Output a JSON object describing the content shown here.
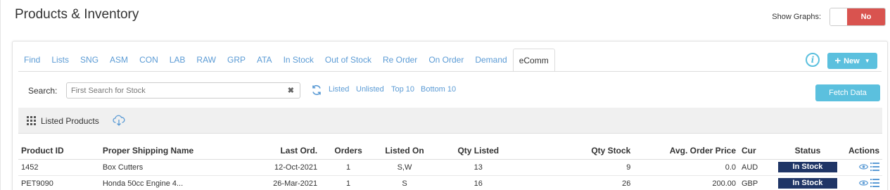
{
  "page": {
    "title": "Products & Inventory",
    "show_graphs_label": "Show Graphs:",
    "show_graphs_value": "No"
  },
  "tabs": [
    "Find",
    "Lists",
    "SNG",
    "ASM",
    "CON",
    "LAB",
    "RAW",
    "GRP",
    "ATA",
    "In Stock",
    "Out of Stock",
    "Re Order",
    "On Order",
    "Demand",
    "eComm"
  ],
  "active_tab": "eComm",
  "toolbar": {
    "new_label": "New",
    "search_label": "Search:",
    "search_placeholder": "First Search for Stock",
    "search_value": "",
    "filters": [
      "Listed",
      "Unlisted",
      "Top 10",
      "Bottom 10"
    ],
    "fetch_label": "Fetch Data"
  },
  "subbar": {
    "title": "Listed Products"
  },
  "table": {
    "headers": [
      "Product ID",
      "Proper Shipping Name",
      "Last Ord.",
      "Orders",
      "Listed On",
      "Qty Listed",
      "Qty Stock",
      "Avg. Order Price",
      "Cur",
      "Status",
      "Actions"
    ],
    "rows": [
      [
        "1452",
        "Box Cutters",
        "12-Oct-2021",
        "1",
        "S,W",
        "13",
        "9",
        "0.0",
        "AUD",
        "In Stock"
      ],
      [
        "PET9090",
        "Honda 50cc Engine 4...",
        "26-Mar-2021",
        "1",
        "S",
        "16",
        "26",
        "200.00",
        "GBP",
        "In Stock"
      ]
    ]
  },
  "colors": {
    "accent": "#5bc0de",
    "link": "#5b9bd5",
    "danger": "#d9534f",
    "status": "#1f3566"
  },
  "icons": {
    "info": "info-icon",
    "clear": "clear-icon",
    "refresh": "refresh-icon",
    "grid": "grid-icon",
    "cloud": "cloud-download-icon",
    "view": "eye-icon",
    "list": "list-icon"
  }
}
